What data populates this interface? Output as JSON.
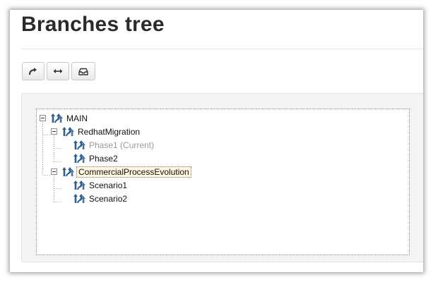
{
  "page": {
    "title": "Branches tree"
  },
  "toolbar": {
    "buttons": [
      {
        "icon": "redo-arrow-icon"
      },
      {
        "icon": "horizontal-arrows-icon"
      },
      {
        "icon": "inbox-tray-icon"
      }
    ]
  },
  "tree": {
    "nodes": [
      {
        "label": "MAIN",
        "depth": 0,
        "expanded": true,
        "icon": "branch-icon"
      },
      {
        "label": "RedhatMigration",
        "depth": 1,
        "expanded": true,
        "icon": "branch-icon"
      },
      {
        "label": "Phase1 (Current)",
        "depth": 2,
        "current": true,
        "icon": "branch-icon"
      },
      {
        "label": "Phase2",
        "depth": 2,
        "icon": "branch-icon"
      },
      {
        "label": "CommercialProcessEvolution",
        "depth": 1,
        "expanded": true,
        "selected": true,
        "icon": "branch-icon"
      },
      {
        "label": "Scenario1",
        "depth": 2,
        "icon": "branch-icon"
      },
      {
        "label": "Scenario2",
        "depth": 2,
        "icon": "branch-icon"
      }
    ]
  },
  "colors": {
    "icon_blue": "#2f5f8f",
    "selected_bg": "#fff7e0",
    "current_text": "#9a9a9a"
  }
}
